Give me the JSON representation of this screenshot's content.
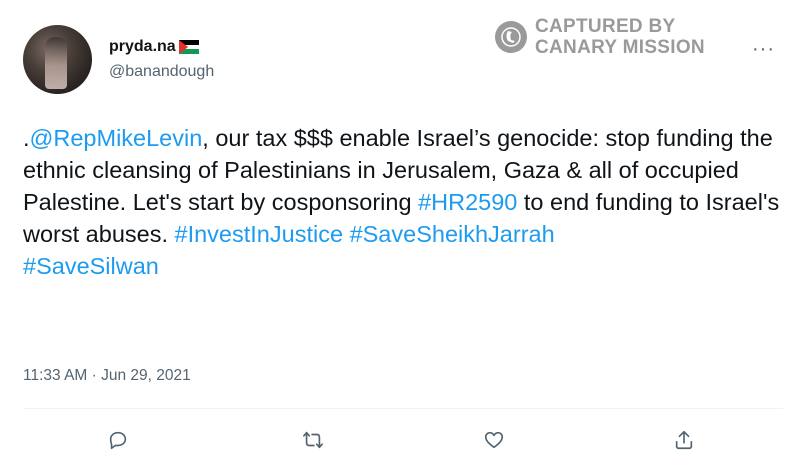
{
  "author": {
    "display_name": "pryda.na",
    "flag": "palestine-flag",
    "handle": "@banandough"
  },
  "watermark": {
    "line1": "CAPTURED BY",
    "line2": "CANARY MISSION",
    "icon": "canary-bird-icon"
  },
  "more_icon": "more-options-icon",
  "tweet": {
    "segments": [
      {
        "text": ".",
        "type": "text"
      },
      {
        "text": "@RepMikeLevin",
        "type": "link"
      },
      {
        "text": ", our tax $$$ enable Israel’s genocide: stop funding the ethnic cleansing of Palestinians in Jerusalem, Gaza & all of occupied Palestine. Let's start by cosponsoring ",
        "type": "text"
      },
      {
        "text": "#HR2590",
        "type": "link"
      },
      {
        "text": " to end funding to Israel's worst abuses. ",
        "type": "text"
      },
      {
        "text": "#InvestInJustice",
        "type": "link"
      },
      {
        "text": " ",
        "type": "text"
      },
      {
        "text": "#SaveSheikhJarrah",
        "type": "link"
      },
      {
        "text": " ",
        "type": "text"
      },
      {
        "text": "#SaveSilwan",
        "type": "link"
      }
    ]
  },
  "timestamp": "11:33 AM · Jun 29, 2021",
  "actions": [
    "reply-icon",
    "retweet-icon",
    "like-icon",
    "share-icon"
  ],
  "colors": {
    "link": "#1d9bf0",
    "secondary_text": "#536471",
    "watermark": "#9a9a9a"
  }
}
